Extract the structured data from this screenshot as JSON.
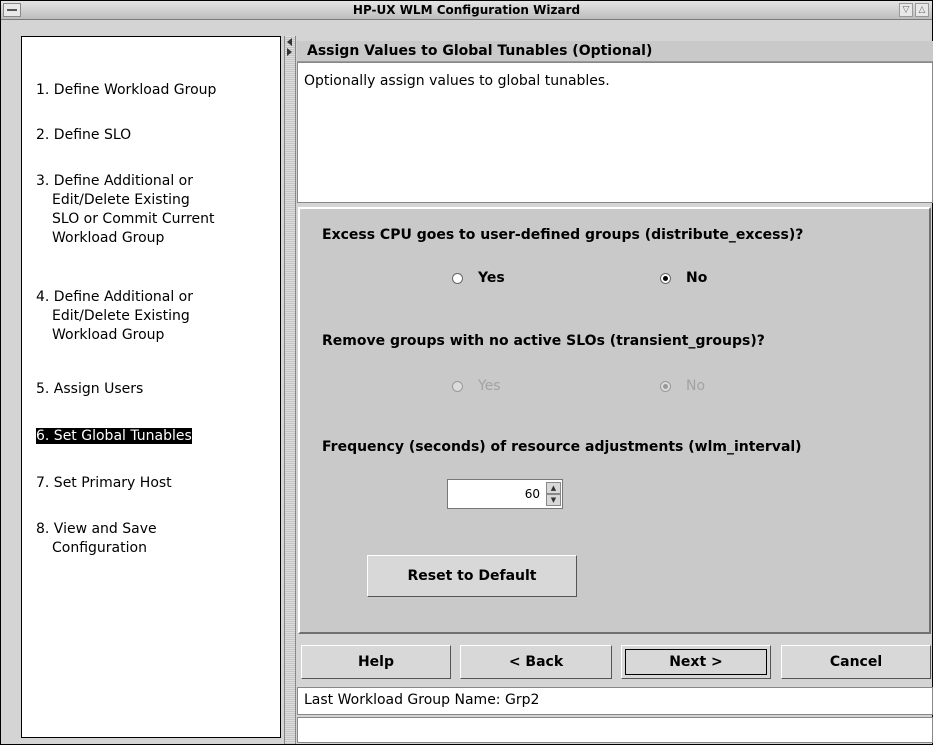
{
  "window": {
    "title": "HP-UX WLM Configuration Wizard",
    "controls": [
      "▽",
      "△"
    ]
  },
  "steps": [
    {
      "label_lines": [
        "1. Define Workload Group"
      ],
      "active": false
    },
    {
      "label_lines": [
        "2. Define SLO"
      ],
      "active": false
    },
    {
      "label_lines": [
        "3. Define Additional or",
        "Edit/Delete Existing",
        "SLO or Commit Current",
        "Workload Group"
      ],
      "active": false
    },
    {
      "label_lines": [
        "4. Define Additional or",
        "Edit/Delete Existing",
        "Workload Group"
      ],
      "active": false
    },
    {
      "label_lines": [
        "5. Assign Users"
      ],
      "active": false
    },
    {
      "label_lines": [
        "6. Set Global Tunables"
      ],
      "active": true
    },
    {
      "label_lines": [
        "7. Set Primary Host"
      ],
      "active": false
    },
    {
      "label_lines": [
        "8. View and Save",
        "Configuration"
      ],
      "active": false
    }
  ],
  "header": {
    "title": "Assign Values to Global Tunables (Optional)",
    "description": "Optionally assign values to global tunables."
  },
  "form": {
    "distribute_excess": {
      "question": "Excess CPU goes to user-defined groups (distribute_excess)?",
      "yes_label": "Yes",
      "no_label": "No",
      "selected": "No",
      "enabled": true
    },
    "transient_groups": {
      "question": "Remove groups with no active SLOs (transient_groups)?",
      "yes_label": "Yes",
      "no_label": "No",
      "selected": "No",
      "enabled": false
    },
    "wlm_interval": {
      "question": "Frequency (seconds) of resource adjustments (wlm_interval)",
      "value": "60"
    },
    "reset_label": "Reset to Default"
  },
  "nav": {
    "help_label": "Help",
    "back_label": "< Back",
    "next_label": "Next >",
    "cancel_label": "Cancel"
  },
  "status": {
    "line1": "Last Workload Group Name: Grp2",
    "line2": ""
  }
}
